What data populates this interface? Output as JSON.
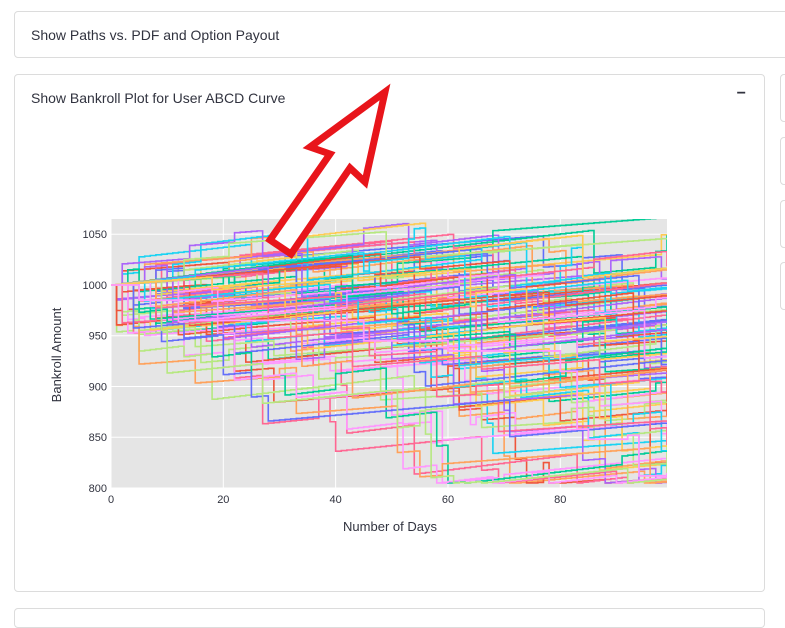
{
  "expanders": {
    "paths_pdf": {
      "title": "Show Paths vs. PDF and Option Payout"
    },
    "bankroll": {
      "title": "Show Bankroll Plot for User ABCD Curve",
      "collapse_symbol": "−"
    }
  },
  "chart_data": {
    "type": "line",
    "title": "",
    "xlabel": "Number of Days",
    "ylabel": "Bankroll Amount",
    "xlim": [
      0,
      99
    ],
    "ylim": [
      800,
      1065
    ],
    "x_ticks": [
      0,
      20,
      40,
      60,
      80
    ],
    "y_ticks": [
      800,
      850,
      900,
      950,
      1000,
      1050
    ],
    "grid": true,
    "background": "#e5e5e5",
    "n_series_estimate": 100,
    "series_shape": "step paths starting at 1000 with slow upward drift and occasional sudden drops",
    "palette": [
      "#636efa",
      "#ef553b",
      "#00cc96",
      "#ab63fa",
      "#ffa15a",
      "#19d3f3",
      "#ff6692",
      "#b6e880",
      "#ff97ff",
      "#fecb52"
    ],
    "highlighted_series": {
      "color": "#ff97ff",
      "points": [
        [
          0,
          1000
        ],
        [
          5,
          985
        ],
        [
          15,
          965
        ],
        [
          45,
          945
        ],
        [
          60,
          935
        ],
        [
          80,
          915
        ],
        [
          83,
          858
        ],
        [
          85,
          848
        ],
        [
          92,
          852
        ],
        [
          94,
          812
        ],
        [
          99,
          815
        ]
      ]
    }
  },
  "annotation": {
    "type": "red-arrow",
    "color": "#e8151b",
    "points_to": "bankroll-expander-title"
  }
}
